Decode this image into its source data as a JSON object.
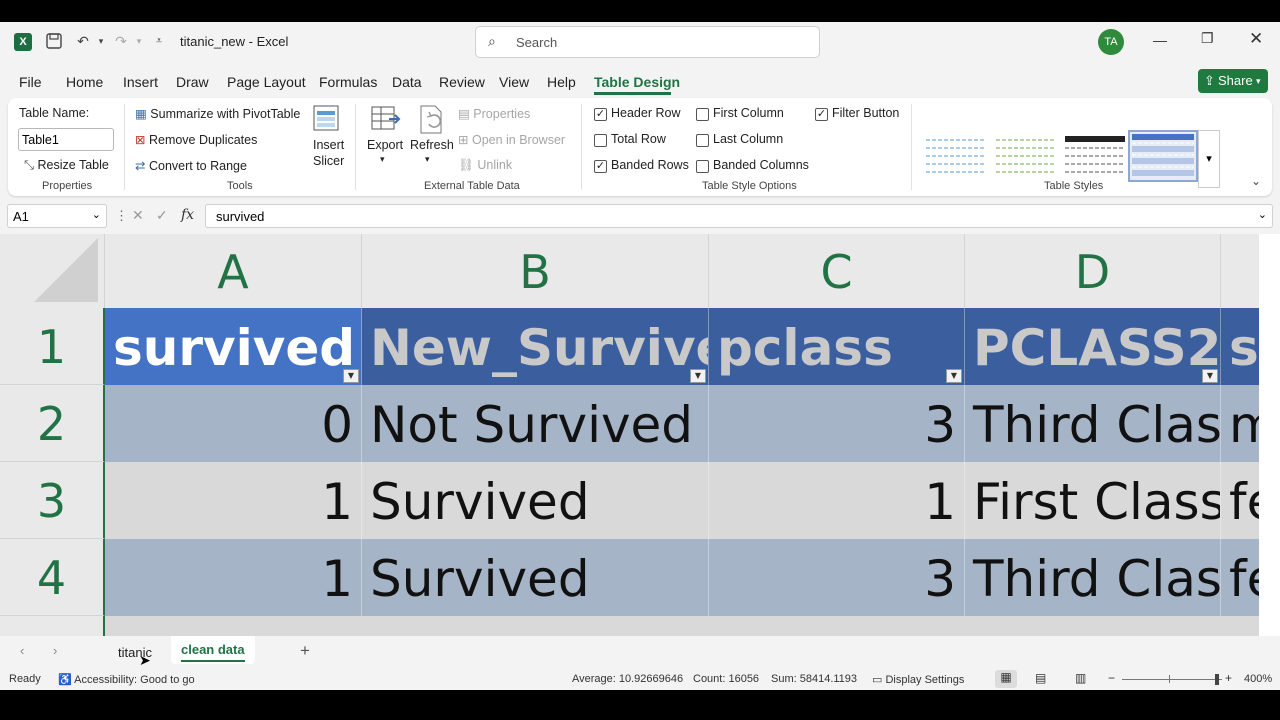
{
  "titlebar": {
    "doc_title": "titanic_new",
    "separator": "-",
    "app_name": "Excel",
    "search_placeholder": "Search",
    "user_initials": "TA"
  },
  "menu": {
    "tabs": [
      "File",
      "Home",
      "Insert",
      "Draw",
      "Page Layout",
      "Formulas",
      "Data",
      "Review",
      "View",
      "Help",
      "Table Design"
    ],
    "active_tab": "Table Design",
    "share_label": "Share"
  },
  "ribbon": {
    "table_name_label": "Table Name:",
    "table_name_value": "Table1",
    "resize_table": "Resize Table",
    "properties_group": "Properties",
    "summarize_pivot": "Summarize with PivotTable",
    "remove_duplicates": "Remove Duplicates",
    "convert_to_range": "Convert to Range",
    "tools_group": "Tools",
    "insert_slicer_line1": "Insert",
    "insert_slicer_line2": "Slicer",
    "export": "Export",
    "refresh": "Refresh",
    "properties": "Properties",
    "open_in_browser": "Open in Browser",
    "unlink": "Unlink",
    "external_group": "External Table Data",
    "header_row": "Header Row",
    "total_row": "Total Row",
    "banded_rows": "Banded Rows",
    "first_column": "First Column",
    "last_column": "Last Column",
    "banded_columns": "Banded Columns",
    "filter_button": "Filter Button",
    "style_options_group": "Table Style Options",
    "table_styles_group": "Table Styles"
  },
  "checkboxes": {
    "header_row": true,
    "total_row": false,
    "banded_rows": true,
    "first_column": false,
    "last_column": false,
    "banded_columns": false,
    "filter_button": true
  },
  "formula_bar": {
    "name_box": "A1",
    "fx": "fx",
    "content": "survived"
  },
  "grid": {
    "columns": [
      "A",
      "B",
      "C",
      "D"
    ],
    "rows": [
      "1",
      "2",
      "3",
      "4"
    ],
    "headers": [
      "survived",
      "New_Survived",
      "pclass",
      "PCLASS2",
      "sex"
    ],
    "data": [
      [
        "0",
        "Not Survived",
        "3",
        "Third Class",
        "male"
      ],
      [
        "1",
        "Survived",
        "1",
        "First Class",
        "female"
      ],
      [
        "1",
        "Survived",
        "3",
        "Third Class",
        "female"
      ]
    ]
  },
  "sheet_tabs": {
    "tabs": [
      "titanic",
      "clean data"
    ],
    "active": "clean data",
    "add": "+"
  },
  "status": {
    "ready": "Ready",
    "accessibility": "Accessibility: Good to go",
    "average": "Average: 10.92669646",
    "count": "Count: 16056",
    "sum": "Sum: 58414.1193",
    "display_settings": "Display Settings",
    "zoom": "400%"
  },
  "colors": {
    "excel_green": "#217346",
    "header_blue": "#4472c4",
    "band_dark": "#a6b4c8",
    "band_light": "#d9d9d9"
  }
}
